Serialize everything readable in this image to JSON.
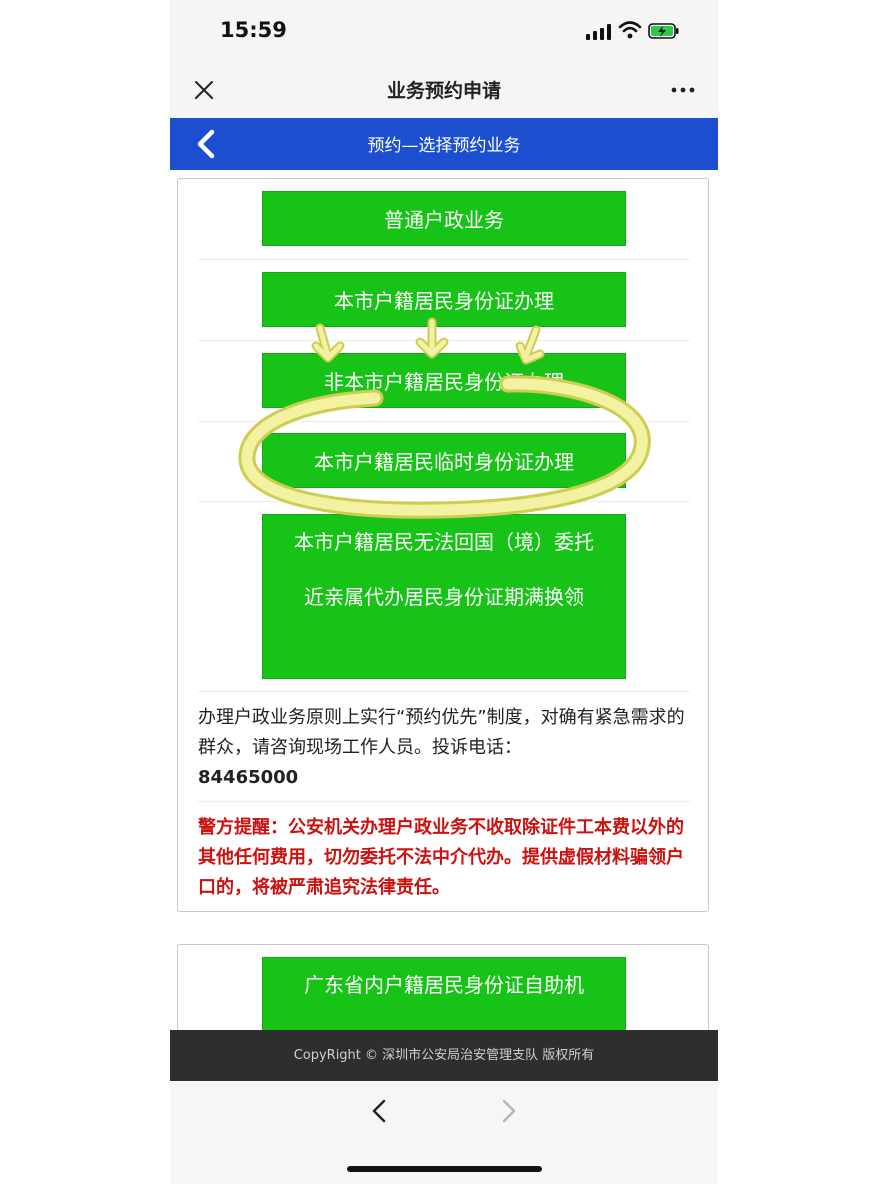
{
  "status_bar": {
    "time": "15:59"
  },
  "nav_bar": {
    "title": "业务预约申请"
  },
  "app_header": {
    "title": "预约—选择预约业务"
  },
  "services": [
    {
      "label": "普通户政业务"
    },
    {
      "label": "本市户籍居民身份证办理"
    },
    {
      "label": "非本市户籍居民身份证办理"
    },
    {
      "label": "本市户籍居民临时身份证办理"
    },
    {
      "label": "本市户籍居民无法回国（境）委托近亲属代办居民身份证期满换领"
    }
  ],
  "notice": {
    "text": "办理户政业务原则上实行“预约优先”制度，对确有紧急需求的群众，请咨询现场工作人员。投诉电话：",
    "hotline": "84465000"
  },
  "warning": {
    "text": "警方提醒：公安机关办理户政业务不收取除证件工本费以外的其他任何费用，切勿委托不法中介代办。提供虚假材料骗领户口的，将被严肃追究法律责任。"
  },
  "services2": [
    {
      "label": "广东省内户籍居民身份证自助机"
    }
  ],
  "footer": {
    "copyright": "CopyRight © 深圳市公安局治安管理支队 版权所有"
  },
  "colors": {
    "header_blue": "#1b4fd0",
    "button_green": "#17c317",
    "warning_red": "#cc1111",
    "highlight_yellow": "#f0ee9a"
  }
}
